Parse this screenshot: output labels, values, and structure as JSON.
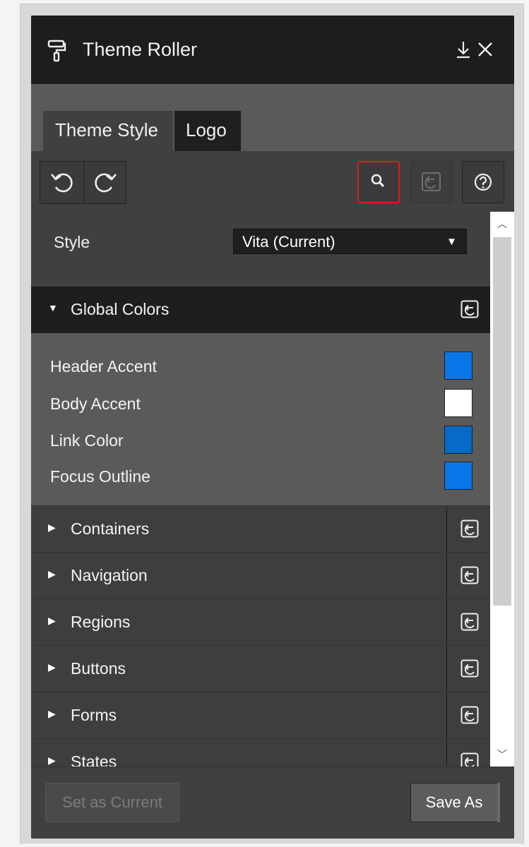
{
  "window": {
    "title": "Theme Roller",
    "dock_icon": "dock-down-icon",
    "close_icon": "close-icon",
    "app_icon": "paint-roller-icon"
  },
  "tabs": [
    {
      "label": "Theme Style",
      "active": true
    },
    {
      "label": "Logo",
      "active": false
    }
  ],
  "toolbar": {
    "undo_icon": "undo-icon",
    "redo_icon": "redo-icon",
    "search_icon": "search-icon",
    "reset_icon": "reset-icon",
    "help_icon": "help-icon"
  },
  "style": {
    "label": "Style",
    "selected": "Vita (Current)"
  },
  "global_colors": {
    "label": "Global Colors",
    "expanded": true,
    "items": [
      {
        "label": "Header Accent",
        "color": "#0a77e8"
      },
      {
        "label": "Body Accent",
        "color": "#ffffff"
      },
      {
        "label": "Link Color",
        "color": "#056ac8"
      },
      {
        "label": "Focus Outline",
        "color": "#0a77e8"
      }
    ]
  },
  "sections": [
    {
      "label": "Containers"
    },
    {
      "label": "Navigation"
    },
    {
      "label": "Regions"
    },
    {
      "label": "Buttons"
    },
    {
      "label": "Forms"
    },
    {
      "label": "States"
    }
  ],
  "footer": {
    "set_current_label": "Set as Current",
    "save_as_label": "Save As"
  },
  "colors": {
    "title_bar": "#1d1d1d",
    "panel": "#404040",
    "focus_border": "#d61f1f"
  }
}
